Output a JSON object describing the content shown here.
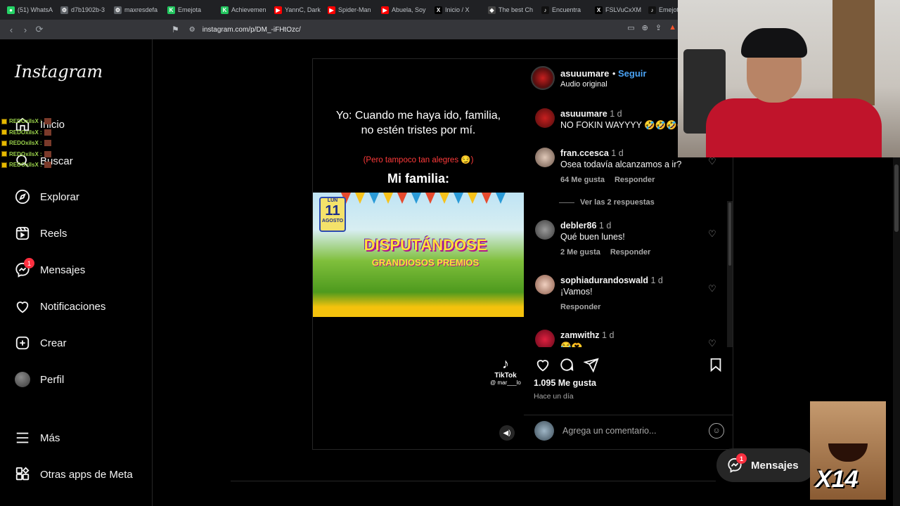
{
  "browser": {
    "tabs": [
      {
        "title": "(51) WhatsA",
        "color": "#25d366",
        "glyph": "●"
      },
      {
        "title": "d7b1902b-3",
        "color": "#5f6368",
        "glyph": "⚙"
      },
      {
        "title": "maxresdefa",
        "color": "#5f6368",
        "glyph": "⚙"
      },
      {
        "title": "Emejota",
        "color": "#22c55e",
        "glyph": "K"
      },
      {
        "title": "Achievemen",
        "color": "#22c55e",
        "glyph": "K"
      },
      {
        "title": "YannC, Dark",
        "color": "#ff0000",
        "glyph": "▶"
      },
      {
        "title": "Spider-Man",
        "color": "#ff0000",
        "glyph": "▶"
      },
      {
        "title": "Abuela, Soy",
        "color": "#ff0000",
        "glyph": "▶"
      },
      {
        "title": "Inicio / X",
        "color": "#000000",
        "glyph": "X"
      },
      {
        "title": "The best Ch",
        "color": "#444444",
        "glyph": "◆"
      },
      {
        "title": "Encuentra",
        "color": "#111111",
        "glyph": "♪"
      },
      {
        "title": "FSLVuCxXM",
        "color": "#000000",
        "glyph": "X"
      },
      {
        "title": "Emejota",
        "color": "#111111",
        "glyph": "♪"
      }
    ],
    "url": "instagram.com/p/DM_-iFHtOzc/"
  },
  "sidebar": {
    "logo": "Instagram",
    "items": [
      {
        "label": "Inicio",
        "icon": "home-icon"
      },
      {
        "label": "Buscar",
        "icon": "search-icon"
      },
      {
        "label": "Explorar",
        "icon": "compass-icon"
      },
      {
        "label": "Reels",
        "icon": "reels-icon"
      },
      {
        "label": "Mensajes",
        "icon": "messenger-icon",
        "badge": "1"
      },
      {
        "label": "Notificaciones",
        "icon": "heart-icon"
      },
      {
        "label": "Crear",
        "icon": "plus-square-icon"
      },
      {
        "label": "Perfil",
        "icon": "avatar"
      },
      {
        "label": "Más",
        "icon": "menu-icon"
      },
      {
        "label": "Otras apps de Meta",
        "icon": "meta-apps-icon"
      }
    ]
  },
  "chat_overlay": {
    "user": "REDOxilsX :"
  },
  "post": {
    "media": {
      "caption_line": "Yo: Cuando me haya ido, familia, no estén tristes por mí.",
      "caption_sub": "(Pero tampoco tan alegres 😏)",
      "caption_family": "Mi familia:",
      "video_day_label": "LUN",
      "video_day": "11",
      "video_month": "AGOSTO",
      "video_title": "DISPUTÁNDOSE",
      "video_subtitle": "GRANDIOSOS PREMIOS",
      "tiktok": "TikTok",
      "tiktok_handle": "@ mar___lo"
    },
    "author": {
      "username": "asuuumare",
      "follow": "Seguir",
      "audio": "Audio original"
    },
    "comments": [
      {
        "user": "asuuumare",
        "time": "1 d",
        "text": "NO FOKIN WAYYYY 🤣🤣🤣🤣",
        "likes": "",
        "reply": ""
      },
      {
        "user": "fran.ccesca",
        "time": "1 d",
        "text": "Osea todavía alcanzamos a ir?",
        "likes": "64 Me gusta",
        "reply": "Responder"
      },
      {
        "user": "debler86",
        "time": "1 d",
        "text": "Qué buen lunes!",
        "likes": "2 Me gusta",
        "reply": "Responder"
      },
      {
        "user": "sophiadurandoswald",
        "time": "1 d",
        "text": "¡Vamos!",
        "likes": "",
        "reply": "Responder"
      },
      {
        "user": "zamwithz",
        "time": "1 d",
        "text": "😂🫶",
        "likes": "",
        "reply": ""
      }
    ],
    "view_replies": "Ver las 2 respuestas",
    "likes_count": "1.095 Me gusta",
    "posted": "Hace un día",
    "comment_placeholder": "Agrega un comentario..."
  },
  "messages_pill": {
    "label": "Mensajes",
    "badge": "1"
  },
  "emote": {
    "text": "X14"
  }
}
